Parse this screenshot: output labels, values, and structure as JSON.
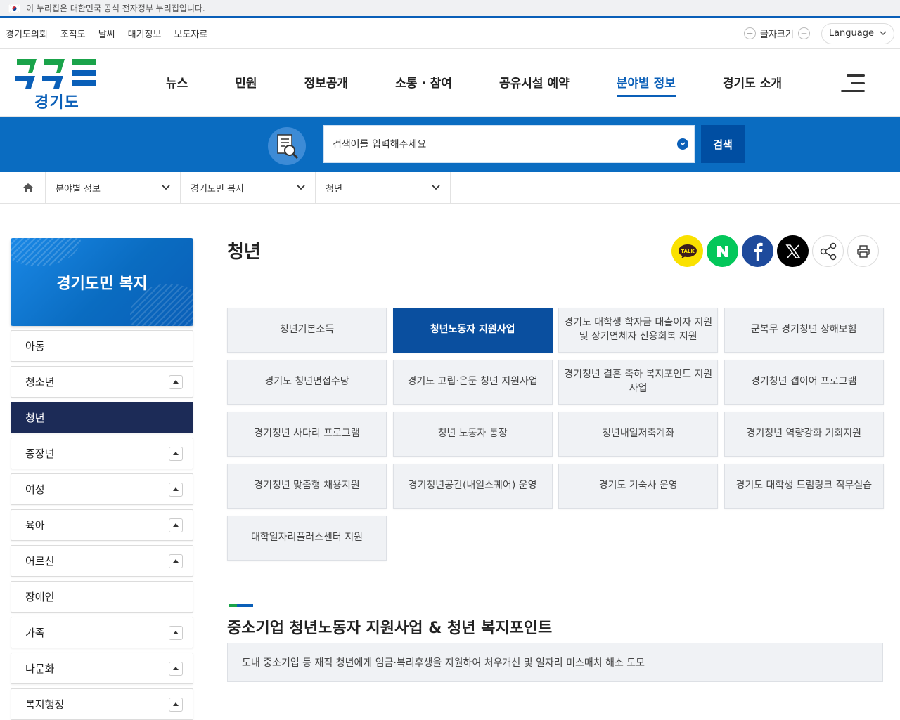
{
  "gov_banner": {
    "text": "이 누리집은 대한민국 공식 전자정부 누리집입니다."
  },
  "util": {
    "links": [
      "경기도의회",
      "조직도",
      "날씨",
      "대기정보",
      "보도자료"
    ],
    "font_size_label": "글자크기",
    "language_label": "Language"
  },
  "logo": {
    "text": "경기도"
  },
  "gnb": {
    "items": [
      "뉴스",
      "민원",
      "정보공개",
      "소통 · 참여",
      "공유시설 예약",
      "분야별 정보",
      "경기도 소개"
    ],
    "active_index": 5
  },
  "search": {
    "placeholder": "검색어를 입력해주세요",
    "button": "검색"
  },
  "breadcrumb": {
    "level1": "분야별 정보",
    "level2": "경기도민 복지",
    "level3": "청년"
  },
  "side": {
    "title": "경기도민 복지",
    "items": [
      {
        "label": "아동",
        "expandable": false
      },
      {
        "label": "청소년",
        "expandable": true
      },
      {
        "label": "청년",
        "expandable": false,
        "active": true
      },
      {
        "label": "중장년",
        "expandable": true
      },
      {
        "label": "여성",
        "expandable": true
      },
      {
        "label": "육아",
        "expandable": true
      },
      {
        "label": "어르신",
        "expandable": true
      },
      {
        "label": "장애인",
        "expandable": false
      },
      {
        "label": "가족",
        "expandable": true
      },
      {
        "label": "다문화",
        "expandable": true
      },
      {
        "label": "복지행정",
        "expandable": true
      }
    ]
  },
  "main": {
    "title": "청년",
    "share_icons": [
      "kakaotalk-icon",
      "naver-icon",
      "facebook-icon",
      "x-icon",
      "share-icon",
      "print-icon"
    ],
    "programs": [
      "청년기본소득",
      "청년노동자 지원사업",
      "경기도 대학생 학자금 대출이자 지원 및 장기연체자 신용회복 지원",
      "군복무 경기청년 상해보험",
      "경기도 청년면접수당",
      "경기도 고립·은둔 청년 지원사업",
      "경기청년 결혼 축하 복지포인트 지원사업",
      "경기청년 갭이어 프로그램",
      "경기청년 사다리 프로그램",
      "청년 노동자 통장",
      "청년내일저축계좌",
      "경기청년 역량강화 기회지원",
      "경기청년 맞춤형 채용지원",
      "경기청년공간(내일스퀘어) 운영",
      "경기도 기숙사 운영",
      "경기도 대학생 드림링크 직무실습",
      "대학일자리플러스센터 지원"
    ],
    "active_program_index": 1,
    "section_title": "중소기업 청년노동자 지원사업 & 청년 복지포인트",
    "section_desc": "도내 중소기업 등 재직 청년에게 임금·복리후생을 지원하여 처우개선 및 일자리 미스매치 해소 도모"
  },
  "colors": {
    "brand_blue": "#0a5fb8",
    "search_band": "#0a6cc1",
    "active_side": "#1c2b57",
    "active_card": "#0a4f9f"
  }
}
